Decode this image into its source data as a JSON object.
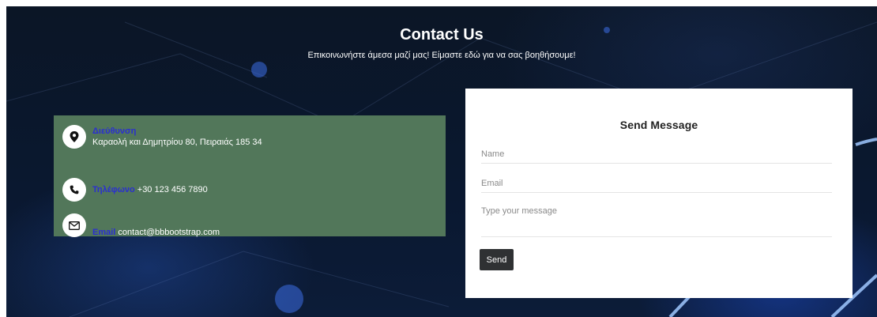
{
  "header": {
    "title": "Contact Us",
    "subtitle": "Επικοινωνήστε άμεσα μαζί μας! Είμαστε εδώ για να σας βοηθήσουμε!"
  },
  "contact_info": {
    "address": {
      "icon": "map-pin-icon",
      "label": "Διεύθυνση",
      "value": "Καραολή και Δημητρίου 80, Πειραιάς 185 34"
    },
    "phone": {
      "icon": "phone-icon",
      "label": "Τηλέφωνο",
      "value": "+30 123 456 7890"
    },
    "email": {
      "icon": "envelope-icon",
      "label": "Email",
      "value": "contact@bbbootstrap.com"
    }
  },
  "form": {
    "title": "Send Message",
    "name_placeholder": "Name",
    "email_placeholder": "Email",
    "message_placeholder": "Type your message",
    "send_label": "Send"
  },
  "colors": {
    "panel_bg": "#52775a",
    "label_color": "#2a2fd0",
    "button_bg": "#2f3133",
    "background": "#0b1626"
  }
}
